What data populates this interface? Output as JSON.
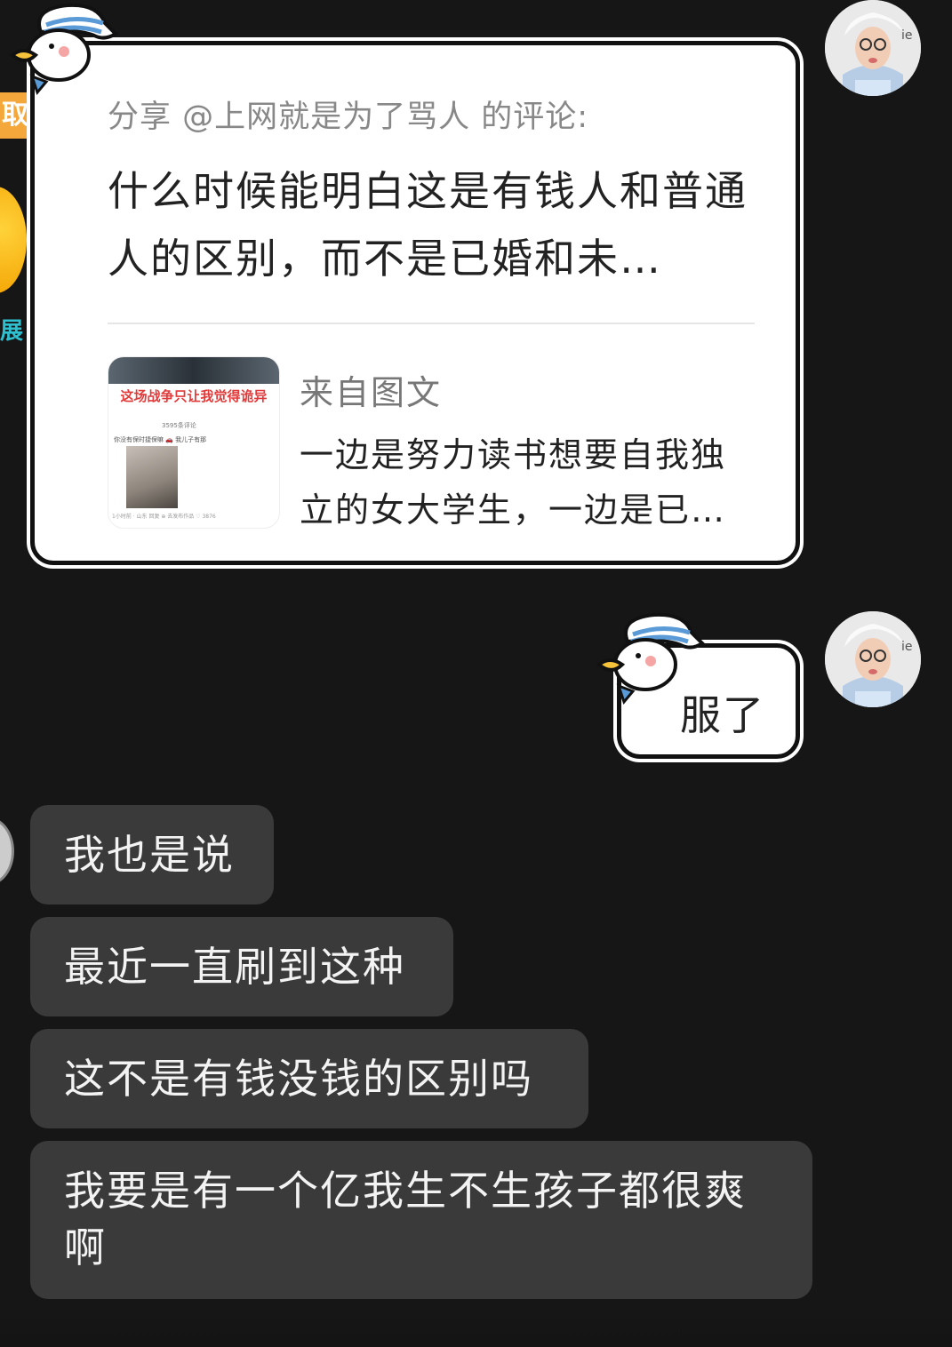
{
  "left_edge": {
    "badge_text": "取",
    "side_text": "展"
  },
  "share_card": {
    "header": "分享 @上网就是为了骂人 的评论:",
    "comment": "什么时候能明白这是有钱人和普通人的区别，而不是已婚和未…",
    "thumbnail": {
      "title": "这场战争只让我觉得诡异",
      "subtitle": "3595条评论",
      "line": "你没有保时捷保嘛 🚗 我儿子有那",
      "footer": "1小时前 · 山东   回复      ⊕ 去发布作品        ♡ 3876"
    },
    "source_label": "来自图文",
    "source_desc": "一边是努力读书想要自我独立的女大学生，一边是已…"
  },
  "sent_message": {
    "text": "服了"
  },
  "received_messages": [
    "我也是说",
    "最近一直刷到这种",
    "这不是有钱没钱的区别吗",
    "我要是有一个亿我生不生孩子都很爽啊"
  ],
  "colors": {
    "background": "#161616",
    "received_bubble": "#3a3a3a",
    "sent_bubble": "#ffffff",
    "accent_badge": "#f4a73a",
    "thumb_title": "#e23a3a"
  },
  "icons": {
    "mascot": "sailor-duck-icon",
    "avatar": "user-avatar"
  }
}
